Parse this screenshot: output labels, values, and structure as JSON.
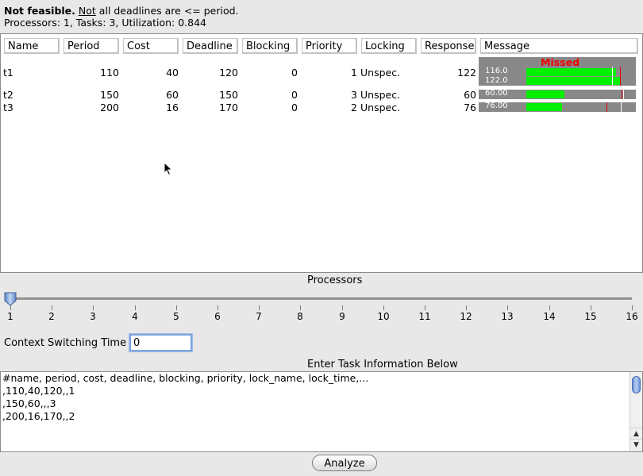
{
  "status": {
    "prefix": "Not feasible.",
    "not_word": "Not",
    "rest": " all deadlines are <= period.",
    "line2": "Processors: 1, Tasks: 3, Utilization: 0.844"
  },
  "table": {
    "headers": [
      "Name",
      "Period",
      "Cost",
      "Deadline",
      "Blocking",
      "Priority",
      "Locking",
      "Response",
      "Message"
    ],
    "rows": [
      {
        "name": "t1",
        "period": "110",
        "cost": "40",
        "deadline": "120",
        "blocking": "0",
        "priority": "1",
        "locking": "Unspec.",
        "response": "122",
        "bar_label_top": "116.0",
        "bar_label_bottom": "122.0",
        "message": "Missed"
      },
      {
        "name": "t2",
        "period": "150",
        "cost": "60",
        "deadline": "150",
        "blocking": "0",
        "priority": "3",
        "locking": "Unspec.",
        "response": "60",
        "bar_label": "60.00"
      },
      {
        "name": "t3",
        "period": "200",
        "cost": "16",
        "deadline": "170",
        "blocking": "0",
        "priority": "2",
        "locking": "Unspec.",
        "response": "76",
        "bar_label": "76.00"
      }
    ]
  },
  "processors": {
    "label": "Processors",
    "ticks": [
      "1",
      "2",
      "3",
      "4",
      "5",
      "6",
      "7",
      "8",
      "9",
      "10",
      "11",
      "12",
      "13",
      "14",
      "15",
      "16"
    ],
    "value": 1
  },
  "context_switching": {
    "label": "Context Switching Time",
    "value": "0"
  },
  "task_input": {
    "label": "Enter Task Information Below",
    "lines": [
      "#name, period, cost, deadline, blocking, priority, lock_name, lock_time,...",
      ",110,40,120,,1",
      ",150,60,,,3",
      ",200,16,170,,2"
    ]
  },
  "analyze_button": "Analyze"
}
